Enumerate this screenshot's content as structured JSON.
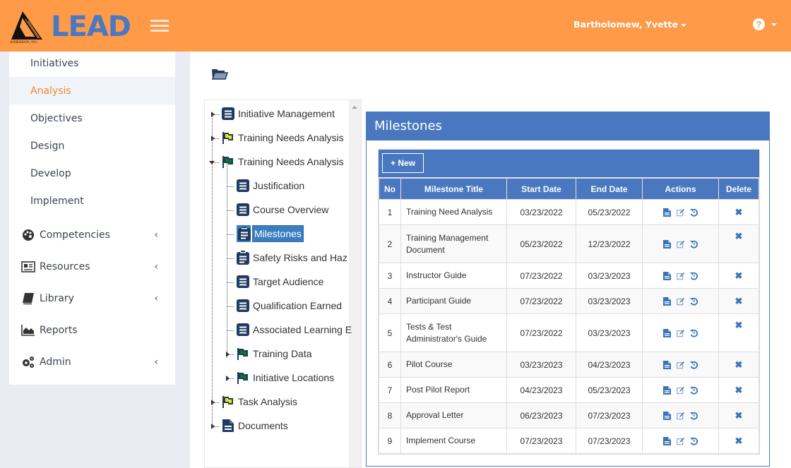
{
  "header": {
    "brand": "LEAD",
    "company": "AIMERRON, INC.",
    "user_name": "Bartholomew, Yvette",
    "help_label": "?"
  },
  "sidebar": {
    "sub_items": [
      {
        "label": "Initiatives",
        "active": false
      },
      {
        "label": "Analysis",
        "active": true
      },
      {
        "label": "Objectives",
        "active": false
      },
      {
        "label": "Design",
        "active": false
      },
      {
        "label": "Develop",
        "active": false
      },
      {
        "label": "Implement",
        "active": false
      }
    ],
    "main_items": [
      {
        "label": "Competencies",
        "icon": "palette-icon",
        "has_children": true
      },
      {
        "label": "Resources",
        "icon": "newspaper-icon",
        "has_children": true
      },
      {
        "label": "Library",
        "icon": "book-icon",
        "has_children": true
      },
      {
        "label": "Reports",
        "icon": "area-chart-icon",
        "has_children": false
      },
      {
        "label": "Admin",
        "icon": "gears-icon",
        "has_children": true
      }
    ],
    "chevron": "‹"
  },
  "tree": {
    "nodes": [
      {
        "label": "Initiative Management",
        "icon": "doc-list-icon",
        "level": 0,
        "expander": "collapsed"
      },
      {
        "label": "Training Needs Analysis",
        "icon": "flag-yellow-icon",
        "level": 0,
        "expander": "collapsed"
      },
      {
        "label": "Training Needs Analysis",
        "icon": "flag-green-icon",
        "level": 0,
        "expander": "expanded"
      },
      {
        "label": "Justification",
        "icon": "doc-list-icon",
        "level": 1,
        "expander": "none"
      },
      {
        "label": "Course Overview",
        "icon": "doc-list-icon",
        "level": 1,
        "expander": "none"
      },
      {
        "label": "Milestones",
        "icon": "clipboard-icon",
        "level": 1,
        "expander": "none",
        "selected": true
      },
      {
        "label": "Safety Risks and Haz",
        "icon": "clipboard-icon",
        "level": 1,
        "expander": "none"
      },
      {
        "label": "Target Audience",
        "icon": "doc-list-icon",
        "level": 1,
        "expander": "none"
      },
      {
        "label": "Qualification Earned",
        "icon": "doc-list-icon",
        "level": 1,
        "expander": "none"
      },
      {
        "label": "Associated Learning E",
        "icon": "doc-list-icon",
        "level": 1,
        "expander": "none"
      },
      {
        "label": "Training Data",
        "icon": "flag-green-icon",
        "level": 1,
        "expander": "collapsed"
      },
      {
        "label": "Initiative Locations",
        "icon": "flag-green-icon",
        "level": 1,
        "expander": "collapsed"
      },
      {
        "label": "Task Analysis",
        "icon": "flag-yellow-icon",
        "level": 0,
        "expander": "collapsed"
      },
      {
        "label": "Documents",
        "icon": "file-icon",
        "level": 0,
        "expander": "collapsed"
      }
    ]
  },
  "panel": {
    "title": "Milestones",
    "new_button": "+ New",
    "columns": [
      "No",
      "Milestone Title",
      "Start Date",
      "End Date",
      "Actions",
      "Delete"
    ],
    "rows": [
      {
        "no": "1",
        "title": "Training Need Analysis",
        "start": "03/23/2022",
        "end": "05/23/2022"
      },
      {
        "no": "2",
        "title": "Training Management Document",
        "start": "05/23/2022",
        "end": "12/23/2022"
      },
      {
        "no": "3",
        "title": "Instructor Guide",
        "start": "07/23/2022",
        "end": "03/23/2023"
      },
      {
        "no": "4",
        "title": "Participant Guide",
        "start": "07/23/2022",
        "end": "03/23/2023"
      },
      {
        "no": "5",
        "title": "Tests & Test Administrator's Guide",
        "start": "07/23/2022",
        "end": "03/23/2023"
      },
      {
        "no": "6",
        "title": "Pilot Course",
        "start": "03/23/2023",
        "end": "04/23/2023"
      },
      {
        "no": "7",
        "title": "Post Pilot Report",
        "start": "04/23/2023",
        "end": "05/23/2023"
      },
      {
        "no": "8",
        "title": "Approval Letter",
        "start": "06/23/2023",
        "end": "07/23/2023"
      },
      {
        "no": "9",
        "title": "Implement Course",
        "start": "07/23/2023",
        "end": "07/23/2023"
      }
    ],
    "delete_glyph": "✖"
  },
  "colors": {
    "header_bg": "#fe9a48",
    "brand_blue": "#4a78c2",
    "active_item": "#f08a32",
    "tree_icon": "#1f3a64",
    "flag_yellow": "#f5ec00",
    "flag_green": "#0a7a1a"
  }
}
